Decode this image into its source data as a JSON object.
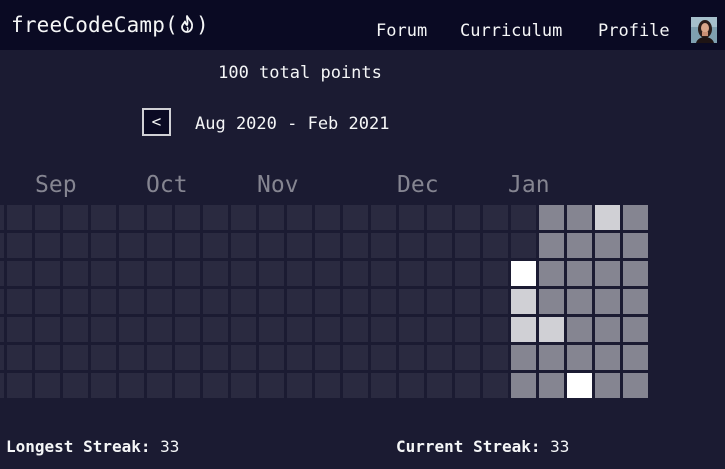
{
  "nav": {
    "logo_text": "freeCodeCamp",
    "logo_paren_open": "(",
    "logo_paren_close": ")",
    "links": [
      "Forum",
      "Curriculum",
      "Profile"
    ]
  },
  "heatmap": {
    "total_points": "100 total points",
    "prev_label": "<",
    "date_range": "Aug 2020 - Feb 2021",
    "months": [
      "Sep",
      "Oct",
      "Nov",
      "Dec",
      "Jan"
    ],
    "levels_recent": [
      [
        1,
        1,
        2,
        1
      ],
      [
        0,
        1,
        1,
        1,
        1
      ],
      [
        3,
        1,
        1,
        1,
        1
      ],
      [
        2,
        1,
        1,
        1,
        1
      ],
      [
        2,
        2,
        1,
        1,
        1
      ],
      [
        1,
        1,
        1,
        1,
        1
      ],
      [
        1,
        1,
        3,
        1,
        1
      ]
    ]
  },
  "stats": {
    "longest_label": "Longest Streak:",
    "longest_value": "33",
    "current_label": "Current Streak:",
    "current_value": "33"
  },
  "colors": {
    "background": "#1b1b32",
    "navbar": "#0a0a23",
    "empty_cell": "#2a2a40",
    "level1": "#858591",
    "level2": "#d0d0d5",
    "level3": "#ffffff"
  }
}
